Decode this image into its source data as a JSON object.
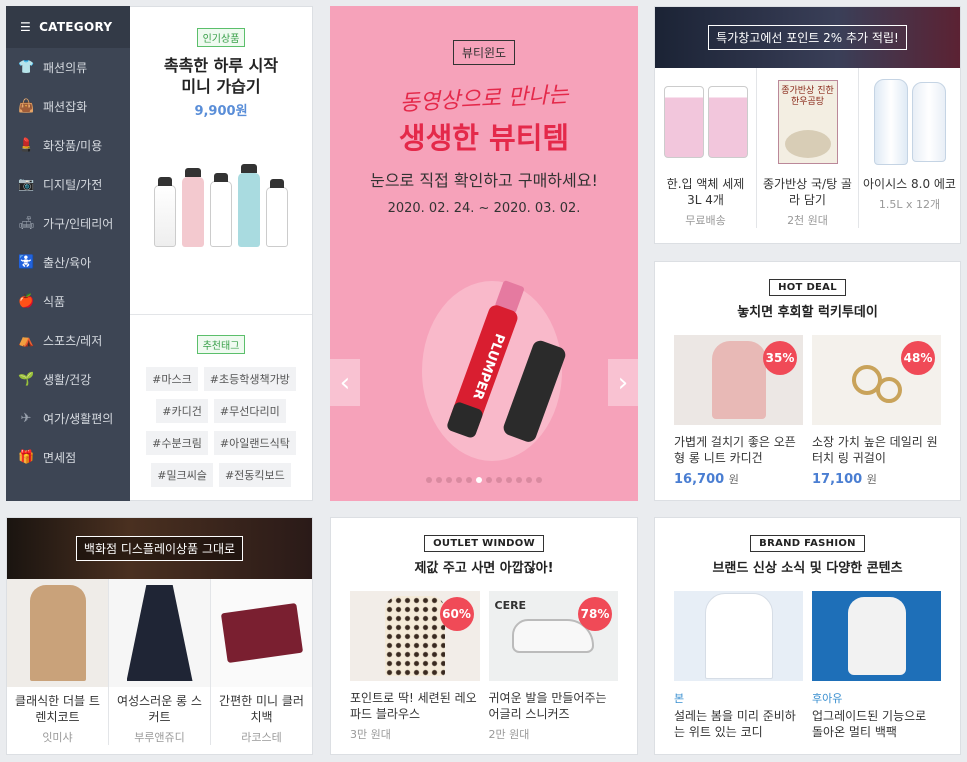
{
  "category": {
    "title": "CATEGORY",
    "items": [
      {
        "label": "패션의류",
        "icon": "shirt-icon",
        "glyph": "👕"
      },
      {
        "label": "패션잡화",
        "icon": "bag-icon",
        "glyph": "👜"
      },
      {
        "label": "화장품/미용",
        "icon": "cosmetics-icon",
        "glyph": "💄"
      },
      {
        "label": "디지털/가전",
        "icon": "camera-icon",
        "glyph": "📷"
      },
      {
        "label": "가구/인테리어",
        "icon": "lamp-icon",
        "glyph": "🛋"
      },
      {
        "label": "출산/육아",
        "icon": "stroller-icon",
        "glyph": "🚼"
      },
      {
        "label": "식품",
        "icon": "apple-icon",
        "glyph": "🍎"
      },
      {
        "label": "스포츠/레저",
        "icon": "tent-icon",
        "glyph": "⛺"
      },
      {
        "label": "생활/건강",
        "icon": "plant-icon",
        "glyph": "🌱"
      },
      {
        "label": "여가/생활편의",
        "icon": "plane-icon",
        "glyph": "✈"
      },
      {
        "label": "면세점",
        "icon": "gift-icon",
        "glyph": "🎁"
      }
    ]
  },
  "popular": {
    "badge": "인기상품",
    "title1": "촉촉한 하루 시작",
    "title2": "미니 가습기",
    "price": "9,900원"
  },
  "recommend": {
    "badge": "추천태그",
    "tags": [
      "#마스크",
      "#초등학생책가방",
      "#카디건",
      "#무선다리미",
      "#수분크림",
      "#아일랜드식탁",
      "#밀크씨슬",
      "#전동킥보드"
    ]
  },
  "beauty": {
    "label": "뷰티윈도",
    "script": "동영상으로 만나는",
    "headline": "생생한 뷰티템",
    "sub": "눈으로 직접 확인하고 구매하세요!",
    "dates": "2020. 02. 24. ~ 2020. 03. 02.",
    "product": "PLUMPER"
  },
  "warehouse": {
    "header": "특가창고에선 포인트 2% 추가 적립!",
    "items": [
      {
        "name": "한.입 액체 세제 3L 4개",
        "sub": "무료배송"
      },
      {
        "name": "종가반상 국/탕 골라 담기",
        "sub": "2천 원대",
        "pack_text": "종가반상 진한 한우곰탕"
      },
      {
        "name": "아이시스 8.0 에코",
        "sub": "1.5L x 12개"
      }
    ]
  },
  "hotdeal": {
    "badge": "HOT DEAL",
    "title": "놓치면 후회할 럭키투데이",
    "items": [
      {
        "name": "가볍게 걸치기 좋은 오픈형 롱 니트 카디건",
        "price": "16,700",
        "unit": "원",
        "pct": "35%"
      },
      {
        "name": "소장 가치 높은 데일리 원터치 링 귀걸이",
        "price": "17,100",
        "unit": "원",
        "pct": "48%"
      }
    ]
  },
  "dept": {
    "header": "백화점 디스플레이상품 그대로",
    "items": [
      {
        "name": "클래식한 더블 트렌치코트",
        "sub": "잇미샤"
      },
      {
        "name": "여성스러운 롱 스커트",
        "sub": "부루앤쥬디"
      },
      {
        "name": "간편한 미니 클러치백",
        "sub": "라코스테"
      }
    ]
  },
  "outlet": {
    "badge": "OUTLET WINDOW",
    "title": "제값 주고 사면 아깝잖아!",
    "items": [
      {
        "name": "포인트로 딱! 세련된 레오파드 블라우스",
        "sub": "3만 원대",
        "pct": "60%"
      },
      {
        "name": "귀여운 발을 만들어주는 어글리 스니커즈",
        "sub": "2만 원대",
        "pct": "78%",
        "shoe_text": "CERE"
      }
    ]
  },
  "brand": {
    "badge": "BRAND FASHION",
    "title": "브랜드 신상 소식 및 다양한 콘텐츠",
    "items": [
      {
        "brand": "본",
        "name": "설레는 봄을 미리 준비하는 위트 있는 코디"
      },
      {
        "brand": "후아유",
        "name": "업그레이드된 기능으로 돌아온 멀티 백팩"
      }
    ]
  }
}
